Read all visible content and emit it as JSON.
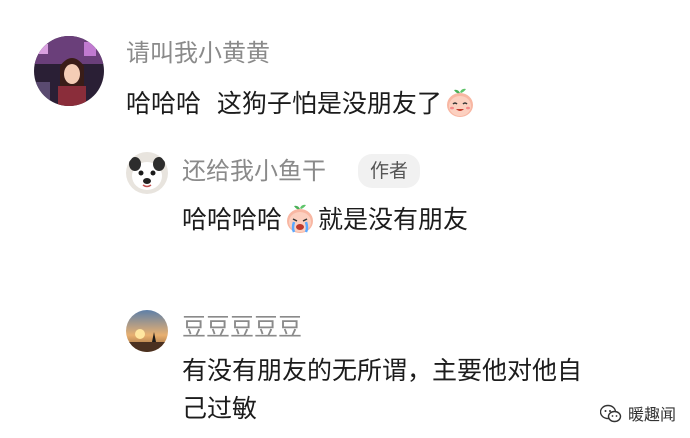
{
  "comments": [
    {
      "username": "请叫我小黄黄",
      "text_before": "哈哈哈  这狗子怕是没朋友了",
      "emoji": "peach-smile-emoji",
      "avatar": "girl-photo-avatar"
    },
    {
      "username": "还给我小鱼干",
      "badge": "作者",
      "text_before": "哈哈哈哈",
      "emoji": "peach-crying-emoji",
      "text_after": "就是没有朋友",
      "avatar": "dog-avatar"
    },
    {
      "username": "豆豆豆豆豆",
      "text_line1": "有没有朋友的无所谓，主要他对他自",
      "text_line2": "己过敏",
      "avatar": "sunset-avatar"
    }
  ],
  "watermark": {
    "icon": "wechat-icon",
    "label": "暖趣闻"
  }
}
